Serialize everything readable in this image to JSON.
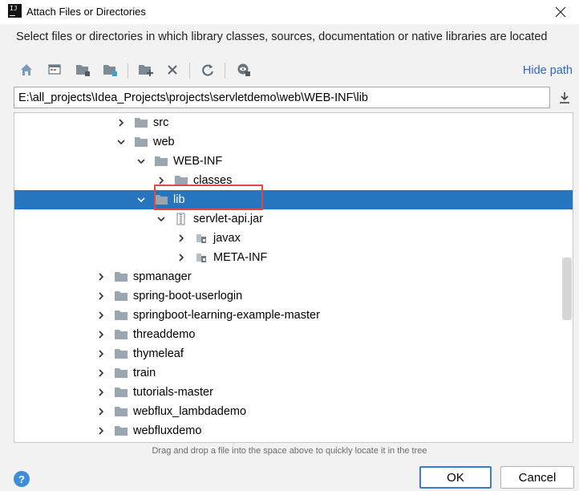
{
  "window": {
    "app_icon": "IJ",
    "title": "Attach Files or Directories",
    "close_icon": "close-icon"
  },
  "instruction": "Select files or directories in which library classes, sources, documentation or native libraries are located",
  "toolbar": {
    "buttons": [
      "home-icon",
      "desktop-icon",
      "project-folder-icon",
      "module-folder-icon",
      "new-folder-icon",
      "delete-icon",
      "refresh-icon",
      "show-hidden-icon"
    ],
    "hide_path_label": "Hide path"
  },
  "path": {
    "value": "E:\\all_projects\\Idea_Projects\\projects\\servletdemo\\web\\WEB-INF\\lib"
  },
  "tree": {
    "selected": "lib",
    "items": [
      {
        "label": "src",
        "expanded": false,
        "icon": "folder-icon"
      },
      {
        "label": "web",
        "expanded": true,
        "icon": "folder-icon"
      },
      {
        "label": "WEB-INF",
        "expanded": true,
        "icon": "folder-icon"
      },
      {
        "label": "classes",
        "expanded": false,
        "icon": "folder-icon"
      },
      {
        "label": "lib",
        "expanded": true,
        "icon": "folder-icon"
      },
      {
        "label": "servlet-api.jar",
        "expanded": true,
        "icon": "jar-icon"
      },
      {
        "label": "javax",
        "expanded": false,
        "icon": "package-icon"
      },
      {
        "label": "META-INF",
        "expanded": false,
        "icon": "package-icon"
      },
      {
        "label": "spmanager",
        "expanded": false,
        "icon": "folder-icon"
      },
      {
        "label": "spring-boot-userlogin",
        "expanded": false,
        "icon": "folder-icon"
      },
      {
        "label": "springboot-learning-example-master",
        "expanded": false,
        "icon": "folder-icon"
      },
      {
        "label": "threaddemo",
        "expanded": false,
        "icon": "folder-icon"
      },
      {
        "label": "thymeleaf",
        "expanded": false,
        "icon": "folder-icon"
      },
      {
        "label": "train",
        "expanded": false,
        "icon": "folder-icon"
      },
      {
        "label": "tutorials-master",
        "expanded": false,
        "icon": "folder-icon"
      },
      {
        "label": "webflux_lambdademo",
        "expanded": false,
        "icon": "folder-icon"
      },
      {
        "label": "webfluxdemo",
        "expanded": false,
        "icon": "folder-icon"
      }
    ]
  },
  "hint": "Drag and drop a file into the space above to quickly locate it in the tree",
  "footer": {
    "help_label": "?",
    "ok_label": "OK",
    "cancel_label": "Cancel"
  },
  "colors": {
    "selection": "#2675bf",
    "link": "#2f65ca",
    "highlight_box": "#e04848",
    "folder": "#9aa7b0"
  }
}
